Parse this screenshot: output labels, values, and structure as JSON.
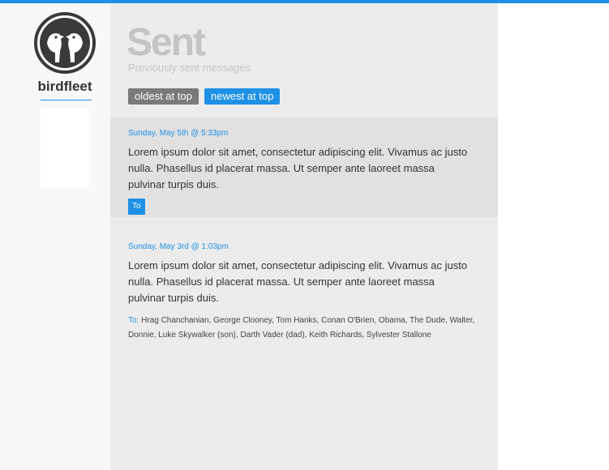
{
  "brand": {
    "name": "birdfleet",
    "accent_color": "#1e90e6",
    "logo_icon": "birds-logo-icon"
  },
  "page": {
    "title": "Sent",
    "subtitle": "Previously sent messages"
  },
  "sort": {
    "oldest_label": "oldest at top",
    "newest_label": "newest at top",
    "active": "newest"
  },
  "messages": [
    {
      "date": "Sunday, May 5th @ 5:33pm",
      "body": "Lorem ipsum dolor sit amet, consectetur adipiscing elit. Vivamus ac justo nulla. Phasellus id placerat massa. Ut semper ante laoreet massa pulvinar turpis duis.",
      "to_label": "To"
    },
    {
      "date": "Sunday, May 3rd @ 1:03pm",
      "body": "Lorem ipsum dolor sit amet, consectetur adipiscing elit. Vivamus ac justo nulla. Phasellus id placerat massa. Ut semper ante laoreet massa pulvinar turpis duis.",
      "to_label": "To:",
      "recipients": "Hrag Chanchanian, George Clooney, Tom Hanks, Conan O'Brien, Obama, The Dude, Walter, Donnie, Luke Skywalker (son), Darth Vader (dad), Keith Richards, Sylvester Stallone"
    }
  ]
}
